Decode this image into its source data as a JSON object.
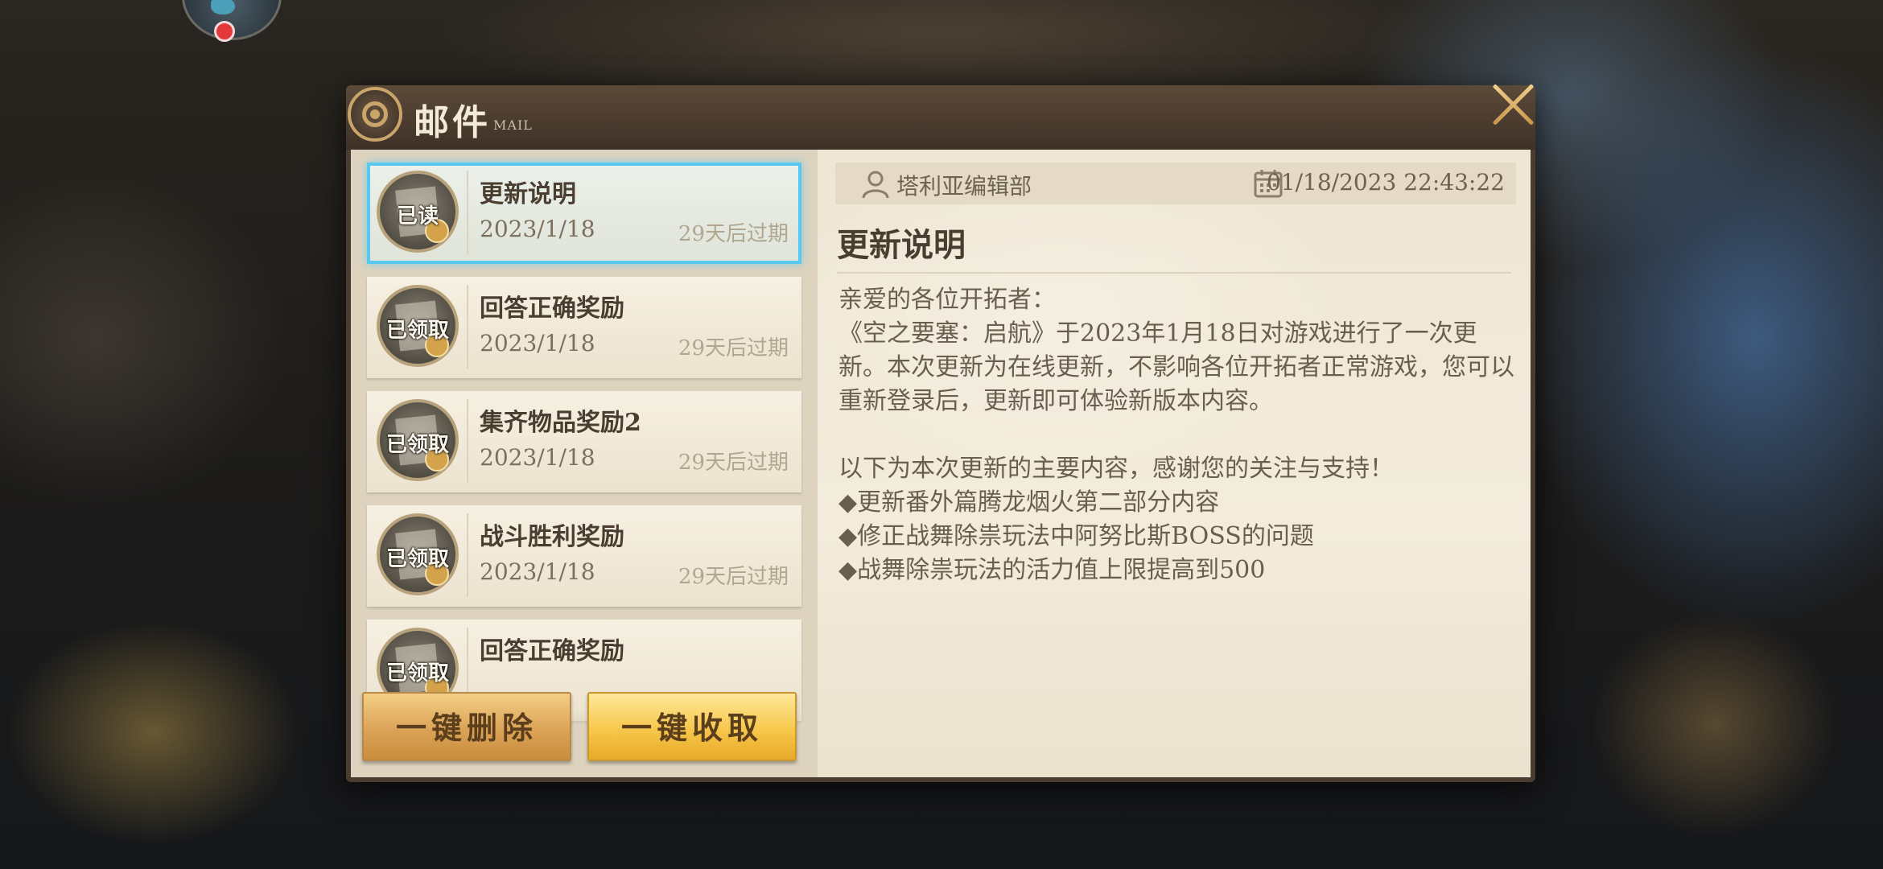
{
  "dialog": {
    "title": "邮件",
    "subtitle": "MAIL"
  },
  "mail_list": [
    {
      "title": "更新说明",
      "date": "2023/1/18",
      "expire": "29天后过期",
      "status": "已读",
      "selected": true
    },
    {
      "title": "回答正确奖励",
      "date": "2023/1/18",
      "expire": "29天后过期",
      "status": "已领取",
      "selected": false
    },
    {
      "title": "集齐物品奖励2",
      "date": "2023/1/18",
      "expire": "29天后过期",
      "status": "已领取",
      "selected": false
    },
    {
      "title": "战斗胜利奖励",
      "date": "2023/1/18",
      "expire": "29天后过期",
      "status": "已领取",
      "selected": false
    },
    {
      "title": "回答正确奖励",
      "date": "",
      "expire": "",
      "status": "已领取",
      "selected": false
    }
  ],
  "buttons": {
    "delete_all": "一键删除",
    "collect_all": "一键收取"
  },
  "detail": {
    "sender": "塔利亚编辑部",
    "time": "01/18/2023 22:43:22",
    "subject": "更新说明",
    "body": [
      "亲爱的各位开拓者：",
      "《空之要塞：启航》于2023年1月18日对游戏进行了一次更新。本次更新为在线更新，不影响各位开拓者正常游戏，您可以重新登录后，更新即可体验新版本内容。",
      "",
      "以下为本次更新的主要内容，感谢您的关注与支持！",
      "◆更新番外篇腾龙烟火第二部分内容",
      "◆修正战舞除祟玩法中阿努比斯BOSS的问题",
      "◆战舞除祟玩法的活力值上限提高到500"
    ]
  },
  "colors": {
    "selected_border": "#58c8ee",
    "notification_dot": "#e3393a",
    "gold_accent": "#c9a56a"
  },
  "icons": [
    "mail-title-icon",
    "close-icon",
    "mail-item-icon",
    "attachment-clip-icon",
    "person-icon",
    "calendar-icon"
  ]
}
